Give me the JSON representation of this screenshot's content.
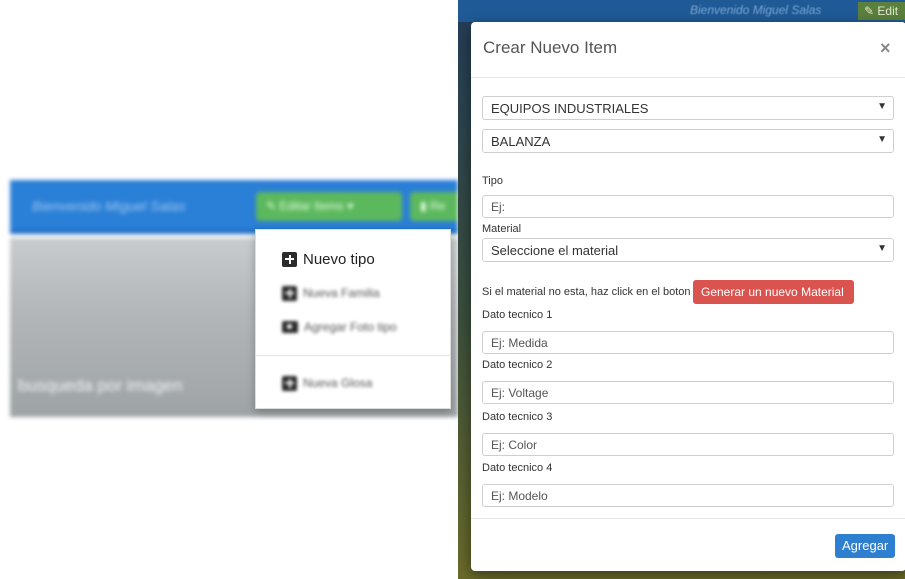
{
  "background": {
    "welcome": "Bienvenido Miguel Salas",
    "edit_button": "Editar Items",
    "edit_caret": "▾",
    "next_button": "Re",
    "image_text": "busqueda por imagen"
  },
  "dropdown": {
    "items": [
      {
        "label": "Nuevo tipo",
        "icon": "plus-square-icon"
      },
      {
        "label": "Nueva Familia",
        "icon": "plus-square-icon"
      },
      {
        "label": "Agregar Foto tipo",
        "icon": "camera-icon"
      },
      {
        "label": "Nueva Glosa",
        "icon": "plus-square-icon"
      }
    ]
  },
  "backdrop": {
    "welcome": "Bienvenido Miguel Salas",
    "edit_button": "Edit"
  },
  "modal": {
    "title": "Crear Nuevo Item",
    "close": "×",
    "select_category": {
      "value": "EQUIPOS INDUSTRIALES"
    },
    "select_subcategory": {
      "value": "BALANZA"
    },
    "tipo": {
      "label": "Tipo",
      "placeholder": "Ej:"
    },
    "material": {
      "label": "Material",
      "value": "Seleccione el material"
    },
    "hint": "Si el material no esta, haz click en el boton",
    "generate_button": "Generar un nuevo Material",
    "dato1": {
      "label": "Dato tecnico 1",
      "placeholder": "Ej: Medida"
    },
    "dato2": {
      "label": "Dato tecnico 2",
      "placeholder": "Ej: Voltage"
    },
    "dato3": {
      "label": "Dato tecnico 3",
      "placeholder": "Ej: Color"
    },
    "dato4": {
      "label": "Dato tecnico 4",
      "placeholder": "Ej: Modelo"
    },
    "add_button": "Agregar",
    "select_arrow": "▼"
  },
  "colors": {
    "navbar": "#2a7fd6",
    "success": "#5cb85c",
    "danger": "#d9534f",
    "primary": "#2f7fd0"
  }
}
